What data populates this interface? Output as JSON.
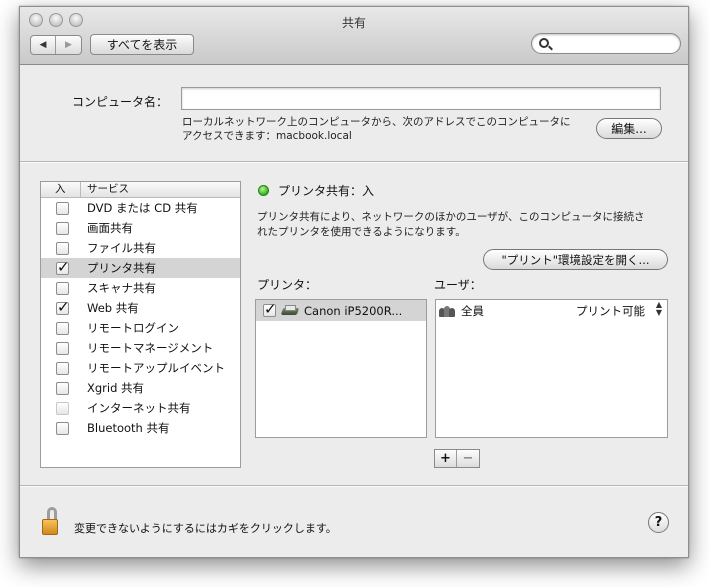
{
  "window": {
    "title": "共有"
  },
  "toolbar": {
    "show_all_label": "すべてを表示",
    "back_icon": "◀",
    "forward_icon": "▶",
    "search_placeholder": ""
  },
  "computer": {
    "label": "コンピュータ名：",
    "name_value": "",
    "description_line1": "ローカルネットワーク上のコンピュータから、次のアドレスでこのコンピュータに",
    "description_line2": "アクセスできます：macbook.local",
    "edit_label": "編集..."
  },
  "services": {
    "header_on": "入",
    "header_service": "サービス",
    "items": [
      {
        "label": "DVD または CD 共有",
        "checked": false,
        "selected": false
      },
      {
        "label": "画面共有",
        "checked": false,
        "selected": false
      },
      {
        "label": "ファイル共有",
        "checked": false,
        "selected": false
      },
      {
        "label": "プリンタ共有",
        "checked": true,
        "selected": true
      },
      {
        "label": "スキャナ共有",
        "checked": false,
        "selected": false
      },
      {
        "label": "Web 共有",
        "checked": true,
        "selected": false
      },
      {
        "label": "リモートログイン",
        "checked": false,
        "selected": false
      },
      {
        "label": "リモートマネージメント",
        "checked": false,
        "selected": false
      },
      {
        "label": "リモートアップルイベント",
        "checked": false,
        "selected": false
      },
      {
        "label": "Xgrid 共有",
        "checked": false,
        "selected": false
      },
      {
        "label": "インターネット共有",
        "checked": false,
        "selected": false,
        "disabled": true
      },
      {
        "label": "Bluetooth 共有",
        "checked": false,
        "selected": false
      }
    ]
  },
  "detail": {
    "status": "プリンタ共有：入",
    "status_color": "#3fbf25",
    "description_line1": "プリンタ共有により、ネットワークのほかのユーザが、このコンピュータに接続さ",
    "description_line2": "れたプリンタを使用できるようになります。",
    "open_prefs_label": "\"プリント\"環境設定を開く...",
    "printers_label": "プリンタ：",
    "users_label": "ユーザ：",
    "printers": [
      {
        "name": "Canon iP5200R...",
        "checked": true
      }
    ],
    "users": [
      {
        "name": "全員",
        "permission": "プリント可能"
      }
    ],
    "add_label": "+",
    "remove_label": "−"
  },
  "footer": {
    "lock_text": "変更できないようにするにはカギをクリックします。",
    "help_label": "?"
  }
}
